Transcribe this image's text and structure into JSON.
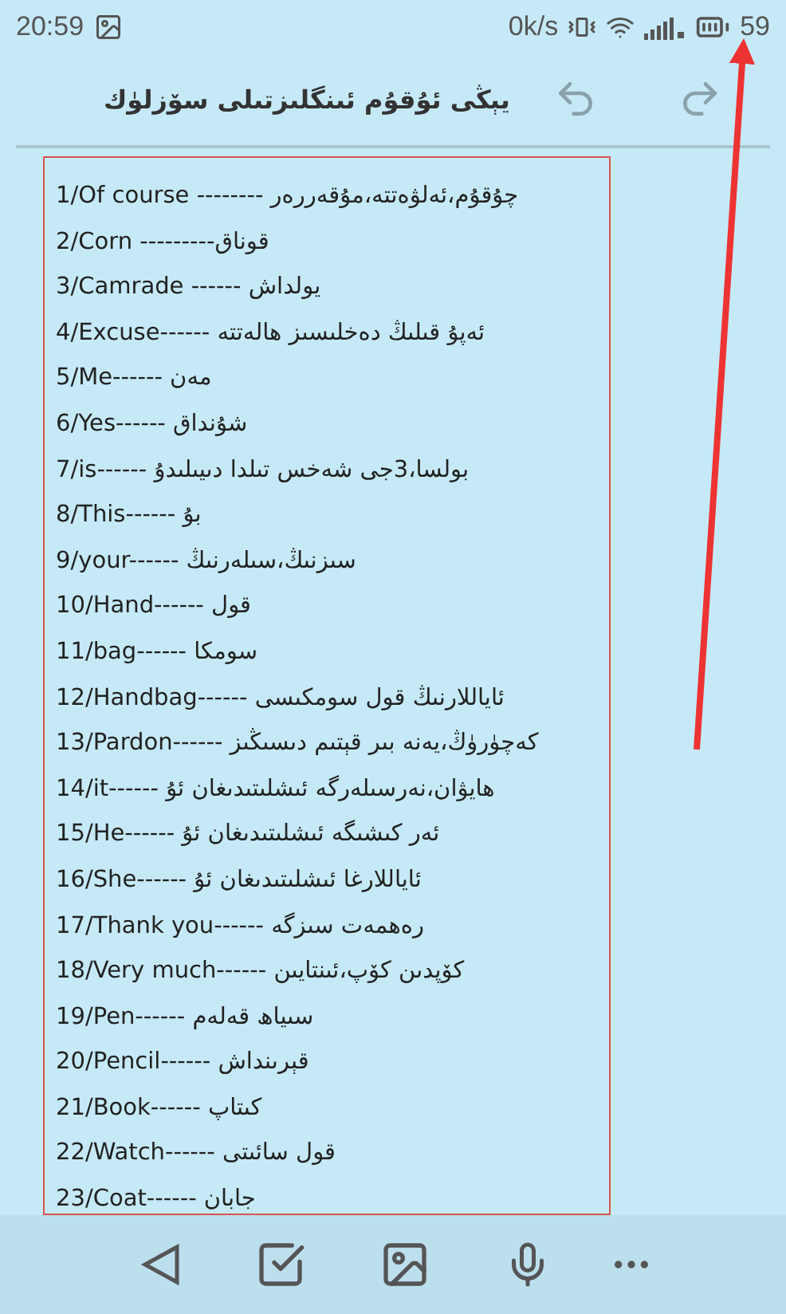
{
  "status_bar": {
    "time": "20:59",
    "network_speed": "0k/s",
    "battery": "59"
  },
  "header": {
    "title": "يېڭى ئۇقۇم ئىنگلىزتىلى سۆزلۈك"
  },
  "entries": [
    "1/Of course -------- چۇقۇم،ئەلۋەتتە،مۇقەررەر",
    "2/Corn ---------قوناق",
    "3/Camrade ------ يولداش",
    "4/Excuse------ ئەپۇ قىلىڭ   دەخلىسىز ھالەتتە",
    "5/Me------ مەن",
    "6/Yes------ شۇنداق",
    "7/is------ بولسا،3جى شەخس تىلدا دىيىلىدۇ",
    "8/This------ بۇ",
    "9/your------ سىزنىڭ،سىلەرنىڭ",
    "10/Hand------ قول",
    "11/bag------ سومكا",
    "12/Handbag------ ئاياللارنىڭ  قول سومكىسى",
    "13/Pardon------ كەچۈرۈڭ،يەنە بىر قېتىم دىسىڭىز",
    "14/it------ ھايۋان،نەرسىلەرگە ئىشلىتىدىغان ئۇ",
    "15/He------ ئەر كىشىگە ئىشلىتىدىغان ئۇ",
    "16/She------ ئاياللارغا ئىشلىتىدىغان ئۇ",
    "17/Thank you------ رەھمەت سىزگە",
    "18/Very much------ كۆپدىن كۆپ،ئىنتايىن",
    "19/Pen------ سىياھ قەلەم",
    "20/Pencil------ قېرىنداش",
    "21/Book------ كىتاپ",
    "22/Watch------ قول سائىتى",
    "23/Coat------ جابان"
  ]
}
